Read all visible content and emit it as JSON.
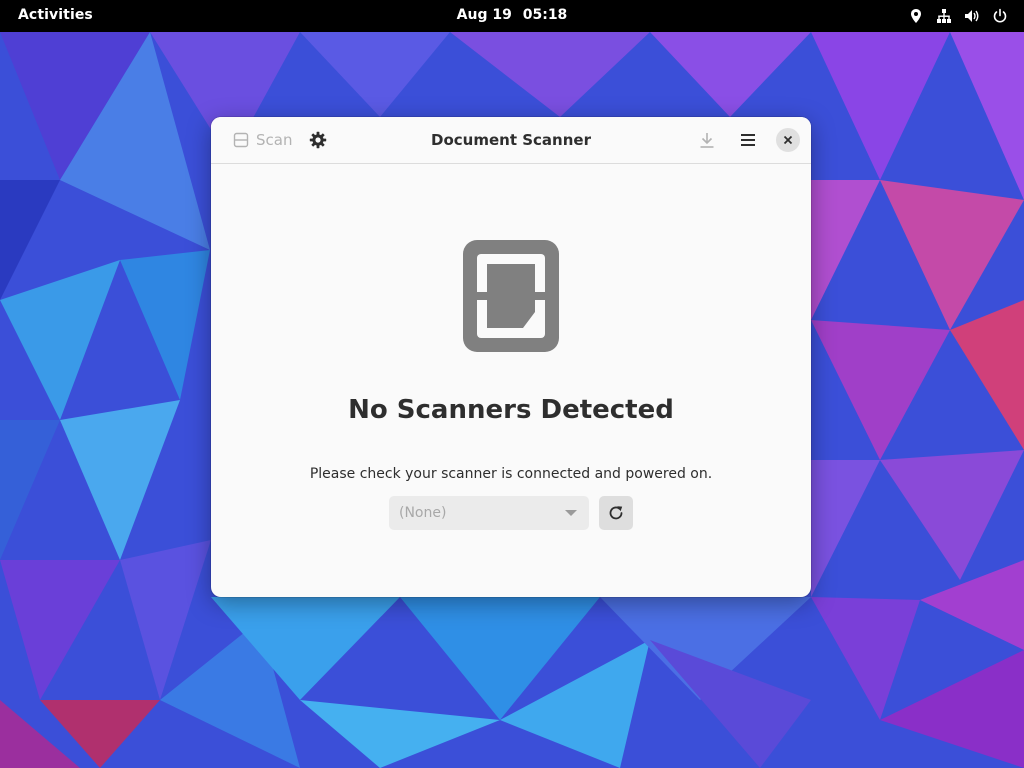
{
  "topbar": {
    "activities_label": "Activities",
    "date": "Aug 19",
    "time": "05:18",
    "tray_icons": [
      "location-icon",
      "network-icon",
      "volume-icon",
      "power-icon"
    ]
  },
  "window": {
    "title": "Document Scanner",
    "scan_label": "Scan",
    "empty_state": {
      "heading": "No Scanners Detected",
      "message": "Please check your scanner is connected and powered on."
    },
    "device_select": {
      "selected": "(None)"
    }
  },
  "colors": {
    "window_bg": "#fafafa",
    "text": "#2e2e2e",
    "disabled_text": "#b3b3b3",
    "icon_gray": "#808080",
    "topbar_bg": "#000000"
  }
}
